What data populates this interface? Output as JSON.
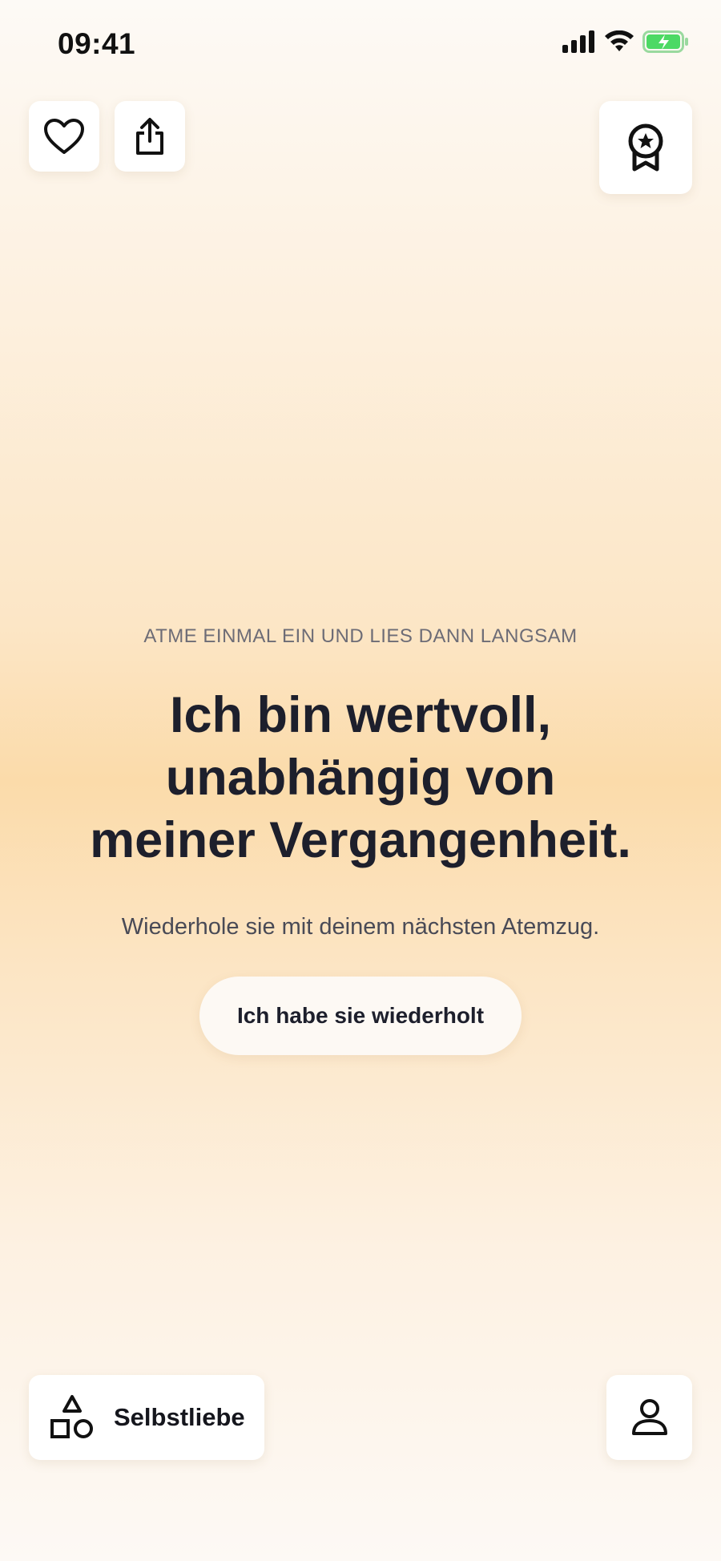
{
  "status_bar": {
    "time": "09:41"
  },
  "main": {
    "instruction": "ATME EINMAL EIN UND LIES DANN LANGSAM",
    "affirmation_lines": [
      "Ich bin wertvoll,",
      "unabhängig von",
      "meiner Vergangenheit."
    ],
    "hint": "Wiederhole sie mit deinem nächsten Atemzug.",
    "repeat_button": "Ich habe sie wiederholt"
  },
  "bottom_bar": {
    "category_label": "Selbstliebe"
  },
  "icons": {
    "favorite": "heart-icon",
    "share": "share-icon",
    "achievements": "award-badge-icon",
    "category": "shapes-icon",
    "profile": "person-icon"
  },
  "colors": {
    "text": "#1d1f2c",
    "muted": "#6d6c76",
    "battery": "#4cd964",
    "accent_glow": "#fbdbaa"
  }
}
